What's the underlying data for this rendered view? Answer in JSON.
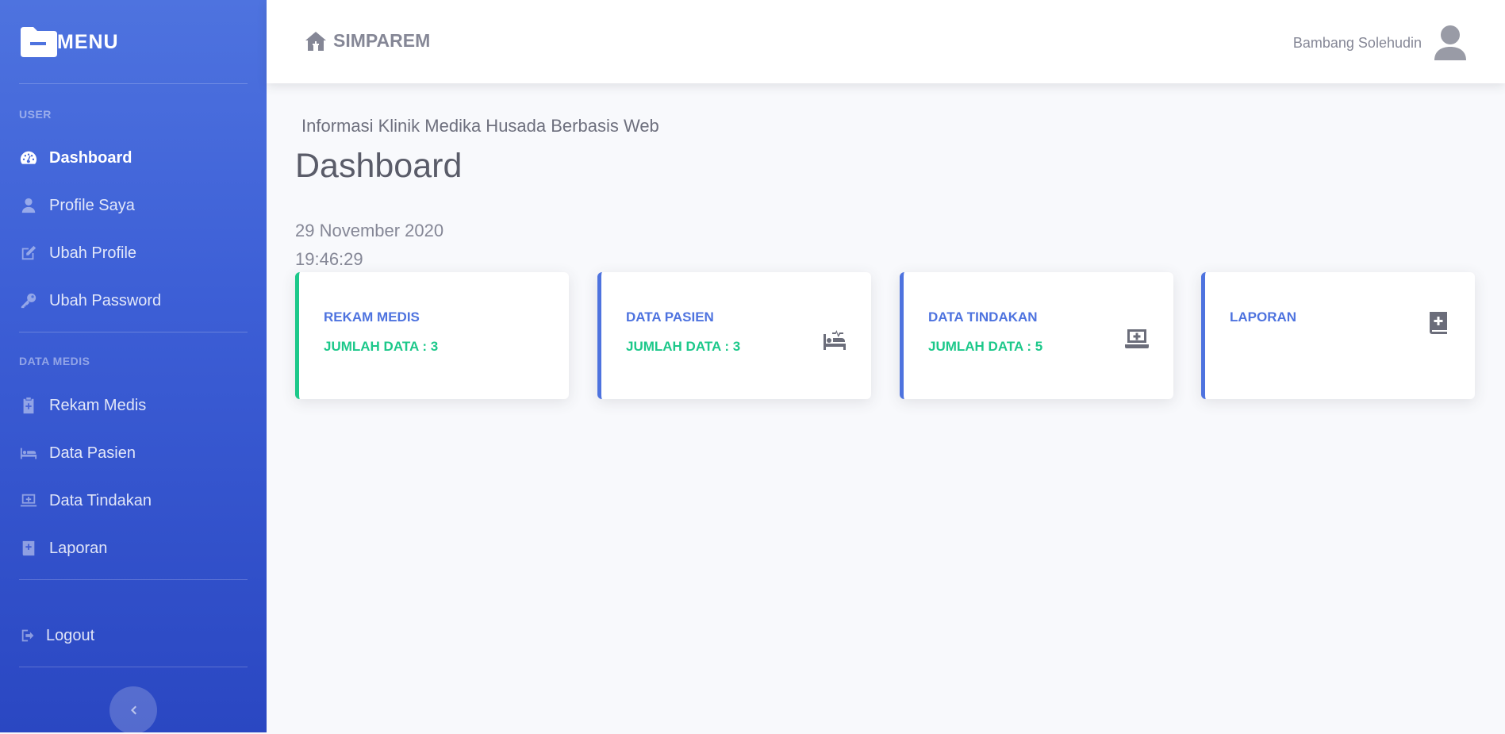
{
  "sidebar": {
    "brand": "MENU",
    "section_user": "USER",
    "section_data": "DATA MEDIS",
    "items": [
      {
        "label": "Dashboard",
        "icon": "tachometer-icon"
      },
      {
        "label": "Profile Saya",
        "icon": "user-icon"
      },
      {
        "label": "Ubah Profile",
        "icon": "edit-icon"
      },
      {
        "label": "Ubah Password",
        "icon": "key-icon"
      },
      {
        "label": "Rekam Medis",
        "icon": "clipboard-medical-icon"
      },
      {
        "label": "Data Pasien",
        "icon": "bed-icon"
      },
      {
        "label": "Data Tindakan",
        "icon": "laptop-medical-icon"
      },
      {
        "label": "Laporan",
        "icon": "book-medical-icon"
      }
    ],
    "logout": "Logout"
  },
  "topbar": {
    "app_title": "SIMPAREM",
    "user_name": "Bambang Solehudin"
  },
  "main": {
    "subtitle": "Informasi Klinik Medika Husada Berbasis Web",
    "title": "Dashboard",
    "date": "29 November 2020",
    "time": "19:46:29"
  },
  "cards": [
    {
      "title": "REKAM MEDIS",
      "count": "JUMLAH DATA : 3",
      "accent": "#1cc88a"
    },
    {
      "title": "DATA PASIEN",
      "count": "JUMLAH DATA : 3",
      "accent": "#4e73df"
    },
    {
      "title": "DATA TINDAKAN",
      "count": "JUMLAH DATA : 5",
      "accent": "#4e73df"
    },
    {
      "title": "LAPORAN",
      "count": "",
      "accent": "#4e73df"
    }
  ],
  "colors": {
    "primary": "#4e73df",
    "success": "#1cc88a",
    "text_muted": "#858796"
  }
}
